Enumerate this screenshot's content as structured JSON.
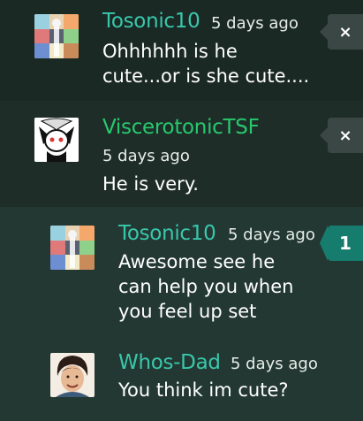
{
  "comments": [
    {
      "username": "Tosonic10",
      "username_color": "#39c7ac",
      "timestamp": "5 days ago",
      "body_lines": [
        "Ohhhhhh is he",
        "cute...or is she cute...."
      ],
      "action": "×",
      "avatar_icon": "character-collage-avatar"
    },
    {
      "username": "ViscerotonicTSF",
      "username_color": "#27c96d",
      "timestamp": "5 days ago",
      "body_lines": [
        "He is very."
      ],
      "action": "×",
      "avatar_icon": "white-cartoon-creature-avatar"
    },
    {
      "username": "Tosonic10",
      "username_color": "#39c7ac",
      "timestamp": "5 days ago",
      "body_lines": [
        "Awesome see he",
        "can help you when",
        "you feel up set"
      ],
      "reply_count": "1",
      "avatar_icon": "character-collage-avatar"
    },
    {
      "username": "Whos-Dad",
      "username_color": "#39c7ac",
      "timestamp": "5 days ago",
      "body_lines": [
        "You think im cute?"
      ],
      "avatar_icon": "smiling-man-portrait-avatar"
    }
  ]
}
